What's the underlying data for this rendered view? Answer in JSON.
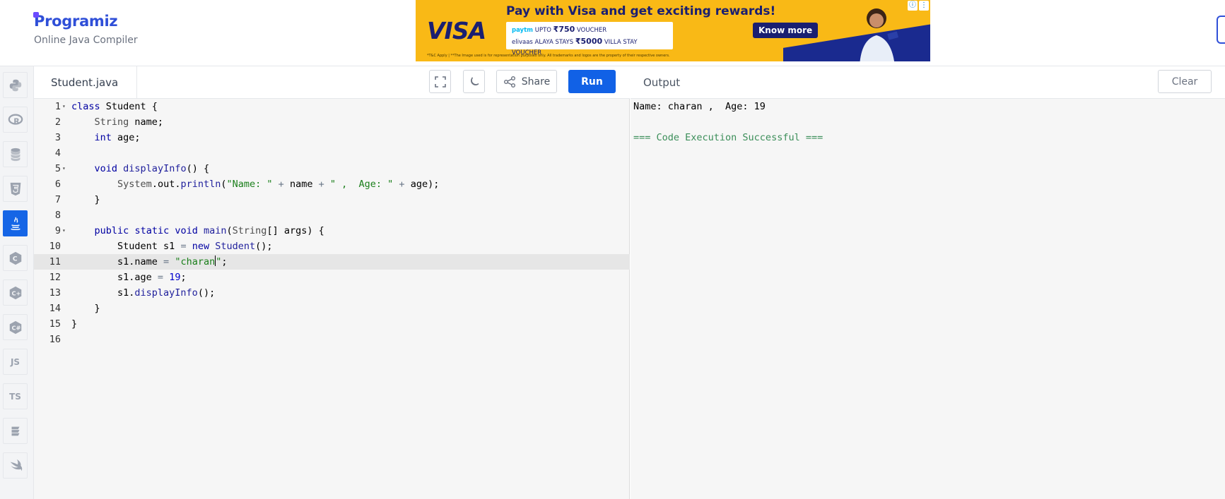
{
  "header": {
    "logo_text": "rogramiz",
    "logo_first_letter": "P",
    "subtitle": "Online Java Compiler"
  },
  "ad": {
    "brand": "VISA",
    "headline": "Pay with Visa and get exciting rewards!",
    "line1_brand": "paytm",
    "line1_text": " UPTO ",
    "line1_amount": "₹750",
    "line1_suffix": " VOUCHER",
    "line2_brand": "elivaas   ALAYA STAYS ",
    "line2_amount": "₹5000",
    "line2_suffix": " VILLA STAY VOUCHER",
    "cta": "Know more",
    "fine_print": "*T&C Apply | **The Image used is for representation purposes only. All trademarks and logos are the property of their respective owners.",
    "info_icon": "info-icon",
    "menu_icon": "more-icon"
  },
  "sidebar": {
    "items": [
      {
        "name": "python",
        "icon": "python-icon"
      },
      {
        "name": "r",
        "icon": "r-icon"
      },
      {
        "name": "sql",
        "icon": "database-icon"
      },
      {
        "name": "html",
        "icon": "html5-icon"
      },
      {
        "name": "java",
        "icon": "java-icon",
        "active": true
      },
      {
        "name": "c",
        "icon": "c-icon"
      },
      {
        "name": "cpp",
        "icon": "cpp-icon"
      },
      {
        "name": "csharp",
        "icon": "csharp-icon"
      },
      {
        "name": "js",
        "label": "JS"
      },
      {
        "name": "ts",
        "label": "TS"
      },
      {
        "name": "go",
        "icon": "go-icon"
      },
      {
        "name": "swift",
        "icon": "swift-icon"
      }
    ]
  },
  "editor": {
    "file_name": "Student.java",
    "fullscreen_icon": "fullscreen-icon",
    "theme_icon": "moon-icon",
    "share_label": "Share",
    "run_label": "Run",
    "active_line": 11,
    "lines": [
      "class Student {",
      "    String name;",
      "    int age;",
      "",
      "    void displayInfo() {",
      "        System.out.println(\"Name: \" + name + \" ,  Age: \" + age);",
      "    }",
      "",
      "    public static void main(String[] args) {",
      "        Student s1 = new Student();",
      "        s1.name = \"charan\";",
      "        s1.age = 19;",
      "        s1.displayInfo();",
      "    }",
      "}",
      ""
    ]
  },
  "output": {
    "title": "Output",
    "clear_label": "Clear",
    "lines": [
      "Name: charan ,  Age: 19",
      "",
      "=== Code Execution Successful ==="
    ]
  }
}
